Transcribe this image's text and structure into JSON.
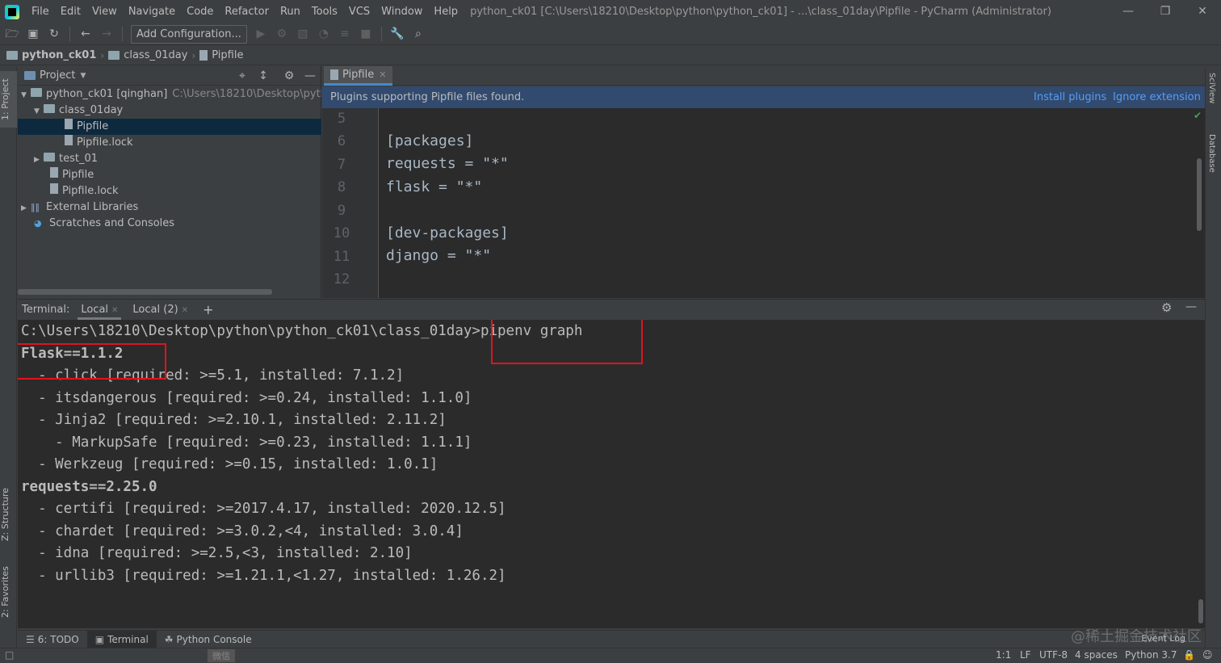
{
  "app": {
    "title": "python_ck01 [C:\\Users\\18210\\Desktop\\python\\python_ck01] - ...\\class_01day\\Pipfile - PyCharm (Administrator)",
    "menu": [
      "File",
      "Edit",
      "View",
      "Navigate",
      "Code",
      "Refactor",
      "Run",
      "Tools",
      "VCS",
      "Window",
      "Help"
    ]
  },
  "toolbar": {
    "add_configuration": "Add Configuration..."
  },
  "breadcrumb": [
    "python_ck01",
    "class_01day",
    "Pipfile"
  ],
  "left_stripe": {
    "project": "1: Project",
    "structure": "Z: Structure",
    "favorites": "2: Favorites"
  },
  "right_stripe": {
    "sciview": "SciView",
    "database": "Database"
  },
  "project_panel": {
    "title": "Project",
    "tree": [
      {
        "label": "python_ck01 [qinghan]",
        "hint": "C:\\Users\\18210\\Desktop\\python\\p"
      },
      {
        "label": "class_01day"
      },
      {
        "label": "Pipfile"
      },
      {
        "label": "Pipfile.lock"
      },
      {
        "label": "test_01"
      },
      {
        "label": "Pipfile"
      },
      {
        "label": "Pipfile.lock"
      },
      {
        "label": "External Libraries"
      },
      {
        "label": "Scratches and Consoles"
      }
    ]
  },
  "editor": {
    "tab": "Pipfile",
    "notice": {
      "text": "Plugins supporting Pipfile files found.",
      "install": "Install plugins",
      "ignore": "Ignore extension"
    },
    "line_numbers": [
      "5",
      "6",
      "7",
      "8",
      "9",
      "10",
      "11",
      "12"
    ],
    "lines": [
      "",
      "[packages]",
      "requests = \"*\"",
      "flask = \"*\"",
      "",
      "[dev-packages]",
      "django = \"*\"",
      ""
    ]
  },
  "terminal": {
    "label": "Terminal:",
    "tabs": [
      "Local",
      "Local (2)"
    ],
    "add": "+",
    "prompt": "C:\\Users\\18210\\Desktop\\python\\python_ck01\\class_01day>",
    "command": "pipenv graph",
    "output": [
      {
        "text": "Flask==1.1.2",
        "bold": true
      },
      {
        "text": "  - click [required: >=5.1, installed: 7.1.2]",
        "bold": false
      },
      {
        "text": "  - itsdangerous [required: >=0.24, installed: 1.1.0]",
        "bold": false
      },
      {
        "text": "  - Jinja2 [required: >=2.10.1, installed: 2.11.2]",
        "bold": false
      },
      {
        "text": "    - MarkupSafe [required: >=0.23, installed: 1.1.1]",
        "bold": false
      },
      {
        "text": "  - Werkzeug [required: >=0.15, installed: 1.0.1]",
        "bold": false
      },
      {
        "text": "requests==2.25.0",
        "bold": true
      },
      {
        "text": "  - certifi [required: >=2017.4.17, installed: 2020.12.5]",
        "bold": false
      },
      {
        "text": "  - chardet [required: >=3.0.2,<4, installed: 3.0.4]",
        "bold": false
      },
      {
        "text": "  - idna [required: >=2.5,<3, installed: 2.10]",
        "bold": false
      },
      {
        "text": "  - urllib3 [required: >=1.21.1,<1.27, installed: 1.26.2]",
        "bold": false
      }
    ]
  },
  "bottom_tabs": {
    "todo": "6: TODO",
    "terminal": "Terminal",
    "python_console": "Python Console"
  },
  "watermark": "@稀土掘金技术社区",
  "event_log": "Event Log",
  "status": {
    "position": "1:1",
    "line_ending": "LF",
    "encoding": "UTF-8",
    "indent": "4 spaces",
    "interpreter": "Python 3.7",
    "ime": "微信"
  },
  "colors": {
    "accent": "#4a88c7",
    "highlight_box": "#e0141e",
    "notice_bg": "#314a6e",
    "link": "#589df6"
  }
}
